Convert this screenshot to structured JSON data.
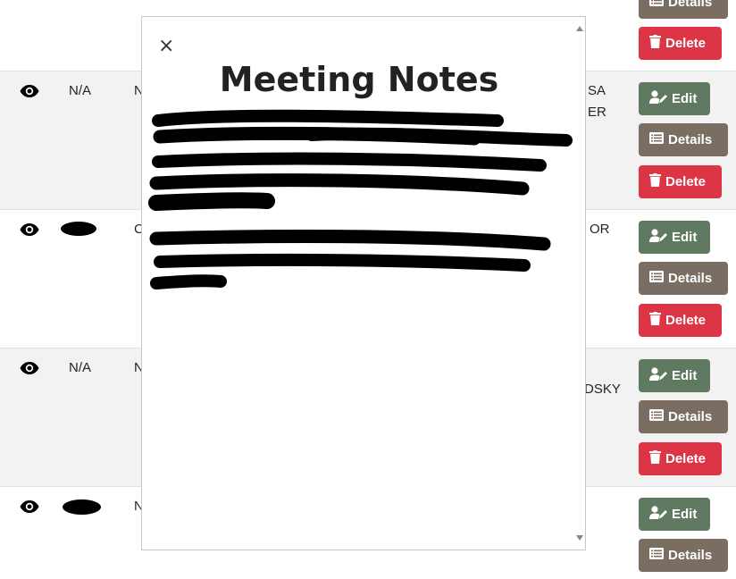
{
  "table": {
    "rows": [
      {
        "col2": "N/A",
        "col3": "N",
        "col4a": "SA",
        "col4b": "ER",
        "shaded": true
      },
      {
        "col2": "",
        "col3": "C",
        "col4a": "OR",
        "col4b": "",
        "shaded": false
      },
      {
        "col2": "N/A",
        "col3": "N",
        "col4a": "",
        "col4b": "DSKY",
        "shaded": true
      },
      {
        "col2": "",
        "col3": "N",
        "col4a": "",
        "col4b": "",
        "shaded": false
      }
    ]
  },
  "buttons": {
    "edit_label": "Edit",
    "details_label": "Details",
    "delete_label": "Delete"
  },
  "modal": {
    "title": "Meeting Notes",
    "close_label": "×"
  },
  "colors": {
    "edit": "#5f7a61",
    "details": "#7a6e63",
    "delete": "#dc3545",
    "row_shade": "#f2f2f2"
  },
  "icons": [
    "eye-icon",
    "user-edit-icon",
    "list-icon",
    "trash-icon",
    "close-icon"
  ]
}
